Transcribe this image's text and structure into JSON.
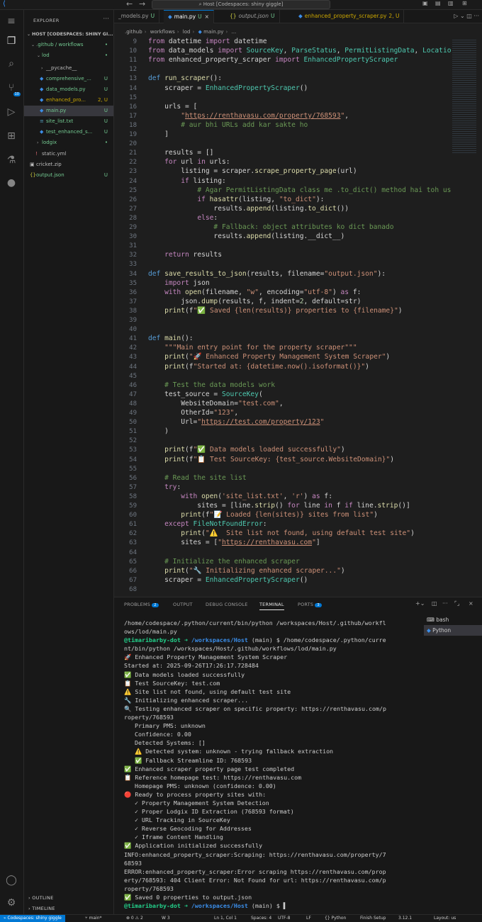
{
  "titlebar": {
    "search": "Host [Codespaces: shiny giggle]"
  },
  "sidebar": {
    "header": "EXPLORER",
    "items": [
      {
        "label": "HOST [CODESPACES: SHINY GI...",
        "status": ""
      },
      {
        "label": ".github / workflows",
        "status": "•"
      },
      {
        "label": "lod",
        "status": "•"
      },
      {
        "label": "__pycache__",
        "status": ""
      },
      {
        "label": "comprehensive_...",
        "status": "U"
      },
      {
        "label": "data_models.py",
        "status": "U"
      },
      {
        "label": "enhanced_pro...",
        "status": "2, U"
      },
      {
        "label": "main.py",
        "status": "U"
      },
      {
        "label": "site_list.txt",
        "status": "U"
      },
      {
        "label": "test_enhanced_s...",
        "status": "U"
      },
      {
        "label": "lodgix",
        "status": "•"
      },
      {
        "label": "static.yml",
        "status": ""
      },
      {
        "label": "cricket.zip",
        "status": ""
      },
      {
        "label": "output.json",
        "status": "U"
      }
    ],
    "outline": "OUTLINE",
    "timeline": "TIMELINE"
  },
  "tabs": [
    {
      "label": "_models.py",
      "status": "U"
    },
    {
      "label": "main.py",
      "status": "U"
    },
    {
      "label": "output.json",
      "status": "U"
    },
    {
      "label": "enhanced_property_scraper.py",
      "status": "2, U"
    }
  ],
  "breadcrumb": [
    ".github",
    "workflows",
    "lod",
    "main.py",
    "..."
  ],
  "editor": {
    "first_line": 9,
    "lines": [
      "from datetime import datetime",
      "from data_models import SourceKey, ParseStatus, PermitListingData, Locatio",
      "from enhanced_property_scraper import EnhancedPropertyScraper",
      "",
      "def run_scraper():",
      "    scraper = EnhancedPropertyScraper()",
      "",
      "    urls = [",
      "        \"https://renthavasu.com/property/768593\",",
      "        # aur bhi URLs add kar sakte ho",
      "    ]",
      "",
      "    results = []",
      "    for url in urls:",
      "        listing = scraper.scrape_property_page(url)",
      "        if listing:",
      "            # Agar PermitListingData class me .to_dict() method hai toh us",
      "            if hasattr(listing, \"to_dict\"):",
      "                results.append(listing.to_dict())",
      "            else:",
      "                # Fallback: object attributes ko dict banado",
      "                results.append(listing.__dict__)",
      "",
      "    return results",
      "",
      "def save_results_to_json(results, filename=\"output.json\"):",
      "    import json",
      "    with open(filename, \"w\", encoding=\"utf-8\") as f:",
      "        json.dump(results, f, indent=2, default=str)",
      "    print(f\"✅ Saved {len(results)} properties to {filename}\")",
      "",
      "",
      "def main():",
      "    \"\"\"Main entry point for the property scraper\"\"\"",
      "    print(\"🚀 Enhanced Property Management System Scraper\")",
      "    print(f\"Started at: {datetime.now().isoformat()}\")",
      "",
      "    # Test the data models work",
      "    test_source = SourceKey(",
      "        WebsiteDomain=\"test.com\",",
      "        OtherId=\"123\",",
      "        Url=\"https://test.com/property/123\"",
      "    )",
      "",
      "    print(f\"✅ Data models loaded successfully\")",
      "    print(f\"📋 Test SourceKey: {test_source.WebsiteDomain}\")",
      "",
      "    # Read the site list",
      "    try:",
      "        with open('site_list.txt', 'r') as f:",
      "            sites = [line.strip() for line in f if line.strip()]",
      "        print(f\"📝 Loaded {len(sites)} sites from list\")",
      "    except FileNotFoundError:",
      "        print(\"⚠️  Site list not found, using default test site\")",
      "        sites = [\"https://renthavasu.com\"]",
      "",
      "    # Initialize the enhanced scraper",
      "    print(\"🔧 Initializing enhanced scraper...\")",
      "    scraper = EnhancedPropertyScraper()",
      ""
    ]
  },
  "panel": {
    "tabs": [
      {
        "label": "PROBLEMS",
        "badge": "2"
      },
      {
        "label": "OUTPUT",
        "badge": ""
      },
      {
        "label": "DEBUG CONSOLE",
        "badge": ""
      },
      {
        "label": "TERMINAL",
        "badge": ""
      },
      {
        "label": "PORTS",
        "badge": "3"
      }
    ],
    "terminals": [
      "bash",
      "Python"
    ],
    "lines": [
      "/home/codespace/.python/current/bin/python /workspaces/Host/.github/workfl",
      "ows/lod/main.py",
      "@timaribarby-dot ➜ /workspaces/Host (main) $ /home/codespace/.python/curre",
      "nt/bin/python /workspaces/Host/.github/workflows/lod/main.py",
      "🚀 Enhanced Property Management System Scraper",
      "Started at: 2025-09-26T17:26:17.728484",
      "✅ Data models loaded successfully",
      "📋 Test SourceKey: test.com",
      "⚠️ Site list not found, using default test site",
      "🔧 Initializing enhanced scraper...",
      "🔍 Testing enhanced scraper on specific property: https://renthavasu.com/p",
      "roperty/768593",
      "   Primary PMS: unknown",
      "   Confidence: 0.00",
      "   Detected Systems: []",
      "   ⚠️ Detected system: unknown - trying fallback extraction",
      "   ✅ Fallback Streamline ID: 768593",
      "✅ Enhanced scraper property page test completed",
      "📋 Reference homepage test: https://renthavasu.com",
      "   Homepage PMS: unknown (confidence: 0.00)",
      "🔴 Ready to process property sites with:",
      "   ✓ Property Management System Detection",
      "   ✓ Proper Lodgix ID Extraction (768593 format)",
      "   ✓ URL Tracking in SourceKey",
      "   ✓ Reverse Geocoding for Addresses",
      "   ✓ Iframe Content Handling",
      "✅ Application initialized successfully",
      "INFO:enhanced_property_scraper:Scraping: https://renthavasu.com/property/7",
      "68593",
      "ERROR:enhanced_property_scraper:Error scraping https://renthavasu.com/prop",
      "erty/768593: 404 Client Error: Not Found for url: https://renthavasu.com/p",
      "roperty/768593",
      "✅ Saved 0 properties to output.json",
      "@timaribarby-dot ➜ /workspaces/Host (main) $ ▌"
    ]
  },
  "statusbar": {
    "remote": "Codespaces: shiny giggle",
    "branch": "main*",
    "errors": "⊗ 0 ⚠ 2",
    "ports": "W 3",
    "position": "Ln 1, Col 1",
    "spaces": "Spaces: 4",
    "encoding": "UTF-8",
    "eol": "LF",
    "language": "Python",
    "finish": "Finish Setup",
    "version": "3.12.1",
    "layout": "Layout: us"
  }
}
